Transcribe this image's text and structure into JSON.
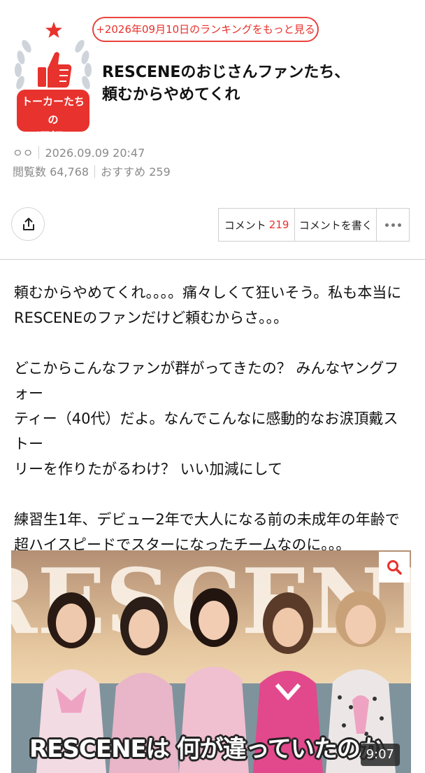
{
  "badge": {
    "line1": "トーカーたちの",
    "line2": "選択!",
    "colors": {
      "red": "#e8322d",
      "laurel": "#cfd4db"
    }
  },
  "ranking_link": "+2026年09月10日のランキングをもっと見る",
  "post": {
    "title_line1": "RESCENEのおじさんファンたち、",
    "title_line2": "頼むからやめてくれ",
    "author": "ㅇㅇ",
    "datetime": "2026.09.09 20:47",
    "views_label": "閲覧数",
    "views": "64,768",
    "recommend_label": "おすすめ",
    "recommend": "259"
  },
  "actions": {
    "share_icon": "share-icon",
    "comment_label": "コメント",
    "comment_count": "219",
    "write_label": "コメントを書く",
    "more_icon": "more-icon"
  },
  "body": {
    "para1_line1": "頼むからやめてくれ。。。。痛々しくて狂いそう。私も本当に",
    "para1_line2": "RESCENEのファンだけど頼むからさ。。。",
    "para2_line1": "どこからこんなファンが群がってきたの？ みんなヤングフォー",
    "para2_line2": "ティー（40代）だよ。なんでこんなに感動的なお涙頂戴ストー",
    "para2_line3": "リーを作りたがるわけ？ いい加減にして",
    "para3_line1": "練習生1年、デビュー2年で大人になる前の未成年の年齢で",
    "para3_line2": "超ハイスピードでスターになったチームなのに。。。"
  },
  "video": {
    "background_text": "RESCENE",
    "caption": "RESCENEは 何が違っていたのか",
    "duration": "9:07",
    "zoom_icon": "zoom-icon"
  }
}
